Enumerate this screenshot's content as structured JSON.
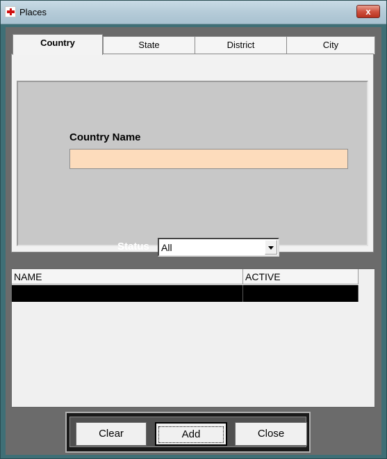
{
  "window": {
    "title": "Places",
    "close_glyph": "x"
  },
  "tabs": [
    {
      "label": "Country",
      "active": true
    },
    {
      "label": "State",
      "active": false
    },
    {
      "label": "District",
      "active": false
    },
    {
      "label": "City",
      "active": false
    }
  ],
  "country_form": {
    "label": "Country Name",
    "value": "",
    "placeholder": ""
  },
  "status": {
    "label": "Status",
    "selected": "All"
  },
  "grid": {
    "columns": [
      "NAME",
      "ACTIVE"
    ],
    "rows": [
      {
        "name": "",
        "active": ""
      }
    ]
  },
  "buttons": {
    "clear": "Clear",
    "add": "Add",
    "close": "Close"
  },
  "colors": {
    "input_background": "#fddcbc",
    "selected_row": "#000000",
    "close_button": "#cf5240"
  }
}
